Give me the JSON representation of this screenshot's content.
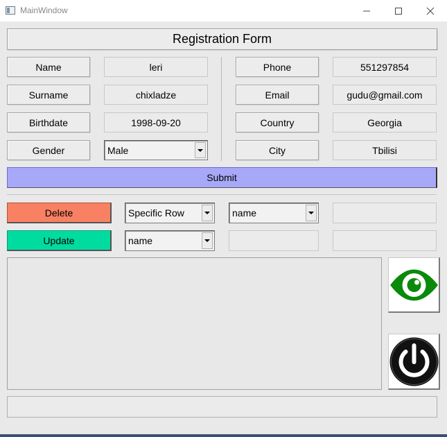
{
  "window": {
    "title": "MainWindow"
  },
  "form": {
    "header": "Registration Form",
    "left_rows": [
      {
        "label": "Name",
        "value": "leri"
      },
      {
        "label": "Surname",
        "value": "chixladze"
      },
      {
        "label": "Birthdate",
        "value": "1998-09-20"
      },
      {
        "label": "Gender",
        "combo_value": "Male"
      }
    ],
    "right_rows": [
      {
        "label": "Phone",
        "value": "551297854"
      },
      {
        "label": "Email",
        "value": "gudu@gmail.com"
      },
      {
        "label": "Country",
        "value": "Georgia"
      },
      {
        "label": "City",
        "value": "Tbilisi"
      }
    ],
    "submit_label": "Submit"
  },
  "actions": {
    "delete_label": "Delete",
    "update_label": "Update",
    "delete_mode_combo": "Specific Row",
    "delete_field_combo": "name",
    "delete_value": "",
    "update_field_combo": "name",
    "update_old_value": "",
    "update_new_value": ""
  },
  "icons": {
    "view": "eye-icon",
    "power": "power-icon"
  },
  "colors": {
    "submit": "#a8a8f8",
    "delete": "#f98163",
    "update": "#00dca0",
    "eye": "#0a8a0a"
  },
  "status_bar_text": ""
}
